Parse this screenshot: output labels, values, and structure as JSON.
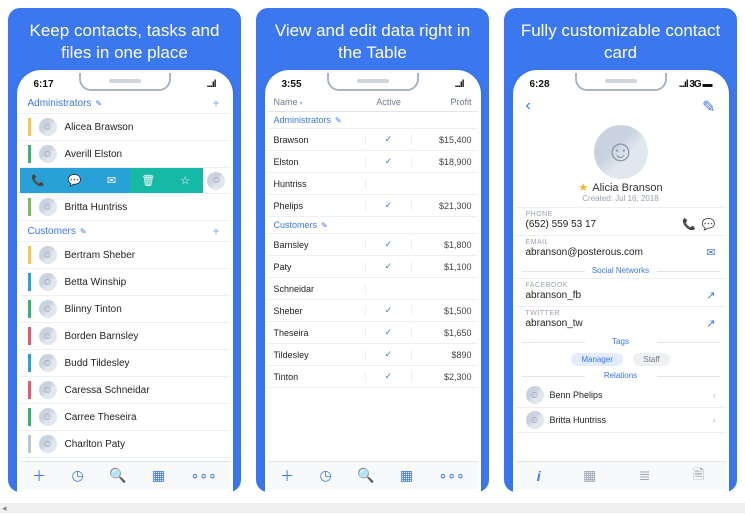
{
  "headlines": {
    "a": "Keep contacts, tasks and files in one place",
    "b": "View and edit data right in the Table",
    "c": "Fully customizable contact card"
  },
  "status": {
    "t1": "6:17",
    "t2": "3:55",
    "t3": "6:28",
    "sig": "...ıl",
    "wifi": "▬",
    "net3": "...ıl 3G ▬"
  },
  "phoneA": {
    "g1": "Administrators",
    "g2": "Customers",
    "admins": [
      {
        "name": "Alicea Brawson",
        "c": "#f6c94b"
      },
      {
        "name": "Averill Elston",
        "c": "#3bb273"
      }
    ],
    "custs": [
      {
        "name": "Britta Huntriss",
        "c": "#7cbf53"
      },
      {
        "name": "Bertram Sheber",
        "c": "#f6c94b"
      },
      {
        "name": "Betta Winship",
        "c": "#2aa0d8"
      },
      {
        "name": "Blinny Tinton",
        "c": "#3bb273"
      },
      {
        "name": "Borden Barnsley",
        "c": "#e85973"
      },
      {
        "name": "Budd Tildesley",
        "c": "#2aa0d8"
      },
      {
        "name": "Caressa Schneidar",
        "c": "#e85973"
      },
      {
        "name": "Carree Theseira",
        "c": "#3bb273"
      },
      {
        "name": "Charlton Paty",
        "c": "#c0c6ce"
      }
    ]
  },
  "phoneB": {
    "cols": {
      "c1": "Name",
      "c2": "Active",
      "c3": "Profit"
    },
    "g1": "Administrators",
    "g2": "Customers",
    "admins": [
      {
        "n": "Brawson",
        "a": true,
        "p": "$15,400"
      },
      {
        "n": "Elston",
        "a": true,
        "p": "$18,900"
      },
      {
        "n": "Huntriss",
        "a": false,
        "p": ""
      },
      {
        "n": "Phelips",
        "a": true,
        "p": "$21,300"
      }
    ],
    "custs": [
      {
        "n": "Barnsley",
        "a": true,
        "p": "$1,800"
      },
      {
        "n": "Paty",
        "a": true,
        "p": "$1,100"
      },
      {
        "n": "Schneidar",
        "a": false,
        "p": ""
      },
      {
        "n": "Sheber",
        "a": true,
        "p": "$1,500"
      },
      {
        "n": "Theseira",
        "a": true,
        "p": "$1,650"
      },
      {
        "n": "Tildesley",
        "a": true,
        "p": "$890"
      },
      {
        "n": "Tinton",
        "a": true,
        "p": "$2,300"
      }
    ]
  },
  "phoneC": {
    "name": "Alicia Branson",
    "created": "Created: Jul 16, 2018",
    "phone_l": "PHONE",
    "phone_v": "(652) 559 53 17",
    "email_l": "EMAIL",
    "email_v": "abranson@posterous.com",
    "social_h": "Social Networks",
    "fb_l": "FACEBOOK",
    "fb_v": "abranson_fb",
    "tw_l": "TWITTER",
    "tw_v": "abranson_tw",
    "tags_h": "Tags",
    "tag1": "Manager",
    "tag2": "Staff",
    "rel_h": "Relations",
    "rel1": "Benn Phelips",
    "rel2": "Britta Huntriss"
  }
}
